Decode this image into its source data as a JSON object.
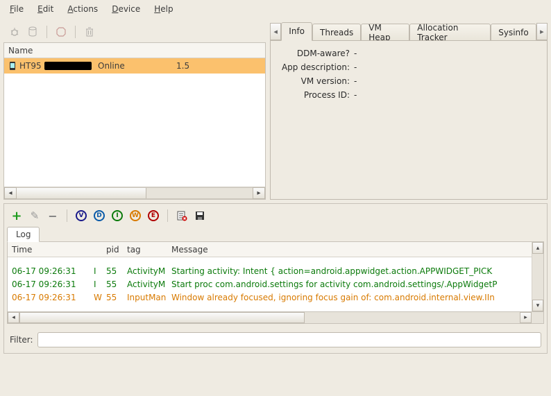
{
  "menubar": {
    "file": "File",
    "edit": "Edit",
    "actions": "Actions",
    "device": "Device",
    "help": "Help"
  },
  "devicelist": {
    "header_name": "Name",
    "row": {
      "name": "HT95",
      "status": "Online",
      "blank": "",
      "version": "1.5"
    }
  },
  "tabs": {
    "info": "Info",
    "threads": "Threads",
    "vmheap": "VM Heap",
    "alloc": "Allocation Tracker",
    "sysinfo": "Sysinfo"
  },
  "info": {
    "ddm_label": "DDM-aware?",
    "ddm_val": "-",
    "appd_label": "App description:",
    "appd_val": "-",
    "vmv_label": "VM version:",
    "vmv_val": "-",
    "pid_label": "Process ID:",
    "pid_val": "-"
  },
  "log_letters": {
    "v": "V",
    "d": "D",
    "i": "I",
    "w": "W",
    "e": "E"
  },
  "log_tab": "Log",
  "log_headers": {
    "time": "Time",
    "pid": "pid",
    "tag": "tag",
    "msg": "Message"
  },
  "log_rows": [
    {
      "cls": "green",
      "time": "06-17 09:26:31",
      "lvl": "I",
      "pid": "55",
      "tag": "ActivityM",
      "msg": "Starting activity: Intent { action=android.appwidget.action.APPWIDGET_PICK"
    },
    {
      "cls": "green",
      "time": "06-17 09:26:31",
      "lvl": "I",
      "pid": "55",
      "tag": "ActivityM",
      "msg": "Start proc com.android.settings for activity com.android.settings/.AppWidgetP"
    },
    {
      "cls": "orange",
      "time": "06-17 09:26:31",
      "lvl": "W",
      "pid": "55",
      "tag": "InputMan",
      "msg": "Window already focused, ignoring focus gain of: com.android.internal.view.IIn"
    }
  ],
  "filter_label": "Filter:"
}
